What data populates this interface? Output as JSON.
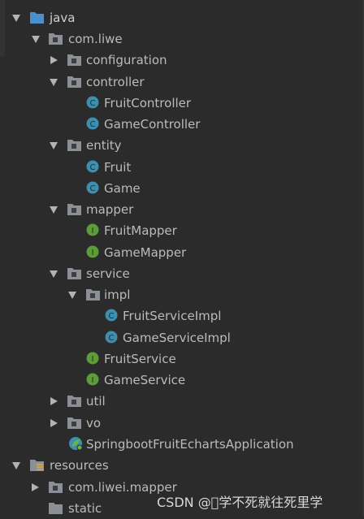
{
  "tree": {
    "java": "java",
    "com_liwe": "com.liwe",
    "configuration": "configuration",
    "controller": "controller",
    "fruit_controller": "FruitController",
    "game_controller": "GameController",
    "entity": "entity",
    "fruit": "Fruit",
    "game": "Game",
    "mapper": "mapper",
    "fruit_mapper": "FruitMapper",
    "game_mapper": "GameMapper",
    "service": "service",
    "impl": "impl",
    "fruit_service_impl": "FruitServiceImpl",
    "game_service_impl": "GameServiceImpl",
    "fruit_service": "FruitService",
    "game_service": "GameService",
    "util": "util",
    "vo": "vo",
    "application": "SpringbootFruitEchartsApplication",
    "resources": "resources",
    "com_liwei_mapper": "com.liwei.mapper",
    "static": "static"
  },
  "icons": {
    "class_letter": "C",
    "interface_letter": "I"
  },
  "watermark": "CSDN @\u0000学不死就往死里学",
  "colors": {
    "background": "#2b2b2b",
    "text": "#bbbbbb",
    "class_icon": "#3d8fb0",
    "interface_icon": "#5e9c3a",
    "folder": "#8c9096",
    "source_folder": "#4a8fcf"
  }
}
